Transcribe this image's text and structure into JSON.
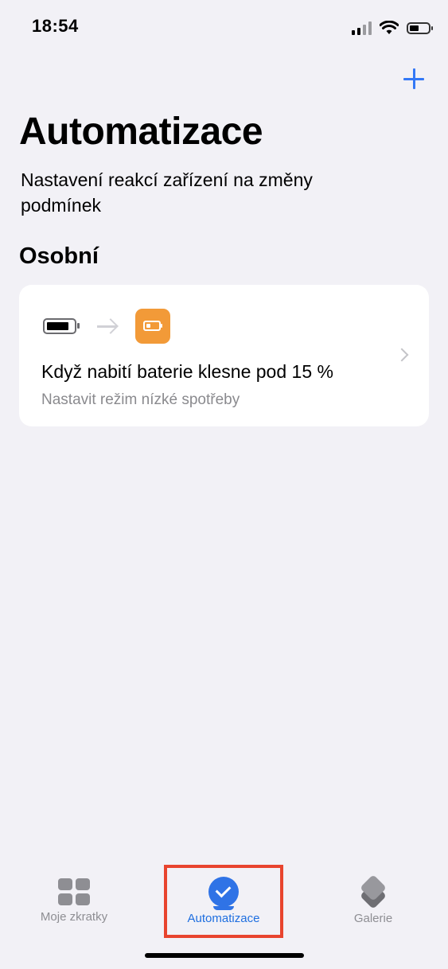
{
  "status_bar": {
    "time": "18:54"
  },
  "header": {
    "title": "Automatizace",
    "subtitle": "Nastavení reakcí zařízení na změny podmínek"
  },
  "sections": [
    {
      "title": "Osobní",
      "automations": [
        {
          "title": "Když nabití baterie klesne pod 15 %",
          "subtitle": "Nastavit režim nízké spotřeby",
          "trigger_icon": "battery-icon",
          "action_icon": "low-power-battery-icon",
          "action_color": "#f29a38"
        }
      ]
    }
  ],
  "tab_bar": {
    "tabs": [
      {
        "label": "Moje zkratky",
        "icon": "grid-icon",
        "active": false
      },
      {
        "label": "Automatizace",
        "icon": "automation-clock-icon",
        "active": true
      },
      {
        "label": "Galerie",
        "icon": "layers-icon",
        "active": false
      }
    ]
  },
  "colors": {
    "accent": "#3478f6",
    "background": "#f2f1f6",
    "highlight": "#e8442e"
  }
}
